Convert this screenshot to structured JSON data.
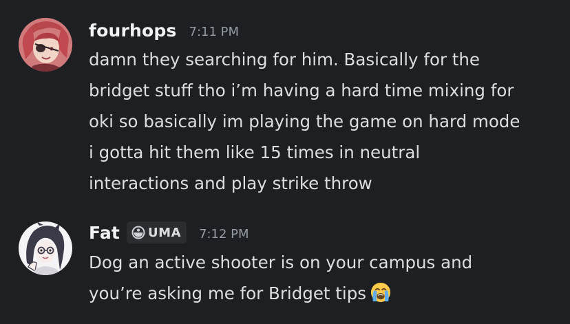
{
  "messages": [
    {
      "username": "fourhops",
      "timestamp": "7:11 PM",
      "lines": [
        "damn they searching for him. Basically for the",
        "bridget stuff tho i’m having a hard time mixing for",
        "oki so basically im playing the game on hard mode",
        "i gotta hit them like 15 times in neutral",
        "interactions and play strike throw"
      ],
      "avatar_icon": "red-haired-character-avatar"
    },
    {
      "username": "Fat",
      "tag": "UMA",
      "tag_icon": "server-tag-icon",
      "timestamp": "7:12 PM",
      "lines": [
        "Dog an active shooter is on your campus and",
        "you’re asking me for Bridget tips"
      ],
      "emoji": "loudly-crying-face",
      "avatar_icon": "dark-haired-character-avatar"
    }
  ],
  "colors": {
    "background": "#1e1f22",
    "text": "#dbdee1",
    "username": "#f2f3f5",
    "timestamp": "#949ba4",
    "tag_background": "#2b2d31"
  }
}
